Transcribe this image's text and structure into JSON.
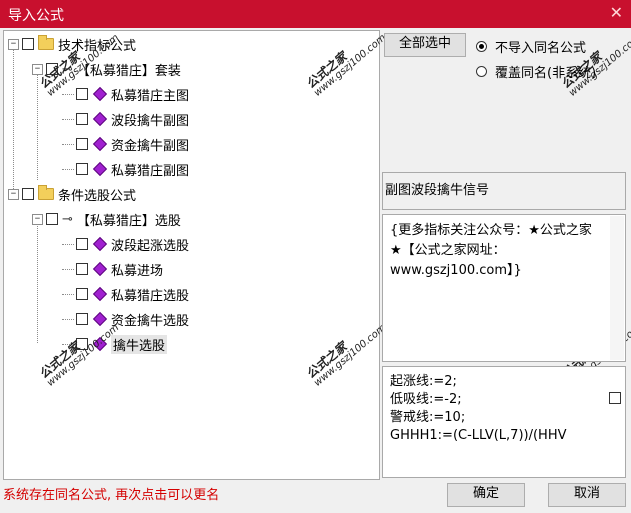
{
  "window": {
    "title": "导入公式",
    "close_glyph": "✕"
  },
  "tree": {
    "group1": "技术指标公式",
    "sub1": "【私募猎庄】套装",
    "items1": [
      "私募猎庄主图",
      "波段擒牛副图",
      "资金擒牛副图",
      "私募猎庄副图"
    ],
    "group2": "条件选股公式",
    "sub2": "【私募猎庄】选股",
    "items2": [
      "波段起涨选股",
      "私募进场",
      "私募猎庄选股",
      "资金擒牛选股",
      "擒牛选股"
    ]
  },
  "buttons": {
    "select_all": "全部选中",
    "ok": "确定",
    "cancel": "取消"
  },
  "radios": {
    "no_import": "不导入同名公式",
    "overwrite": "覆盖同名(非系统)"
  },
  "desc_title": "副图波段擒牛信号",
  "desc_note": "{更多指标关注公众号：★公式之家★【公式之家网址：www.gszj100.com】}",
  "code_lines": [
    "起涨线:=2;",
    "低吸线:=-2;",
    "警戒线:=10;",
    "GHHH1:=(C-LLV(L,7))/(HHV"
  ],
  "status": "系统存在同名公式, 再次点击可以更名",
  "watermark": {
    "brand": "公式之家",
    "url": "www.gszj100.com"
  }
}
